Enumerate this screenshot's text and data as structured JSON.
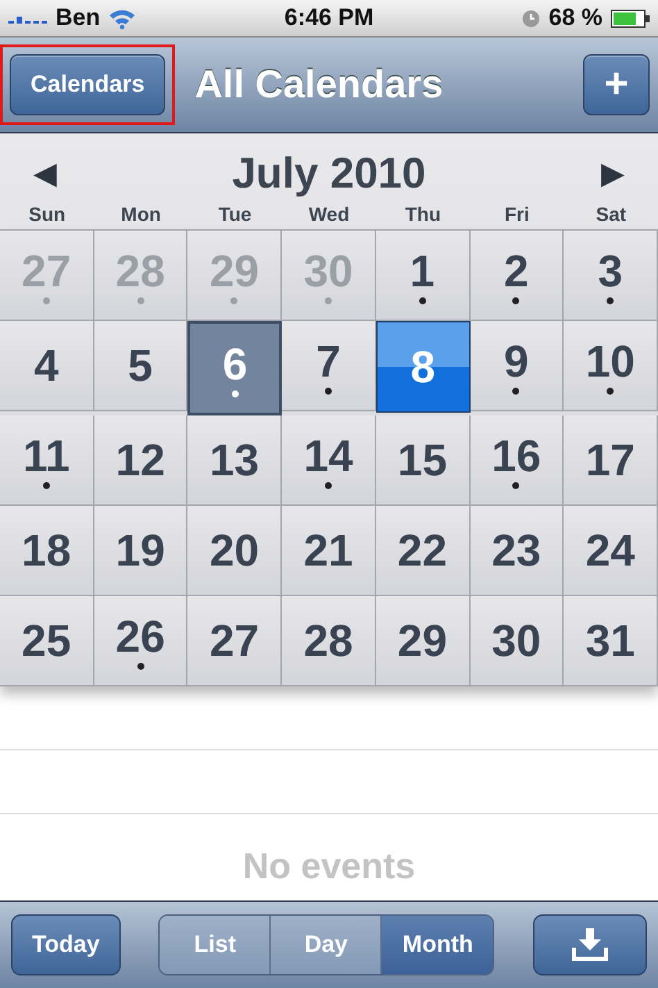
{
  "status_bar": {
    "carrier": "Ben",
    "time": "6:46 PM",
    "battery": "68 %"
  },
  "nav_bar": {
    "left_button": {
      "label": "Calendars",
      "annotated": true
    },
    "title": "All Calendars",
    "right_button": "+"
  },
  "month_header": {
    "title": "July 2010",
    "prev": "◀",
    "next": "▶"
  },
  "weekdays": [
    "Sun",
    "Mon",
    "Tue",
    "Wed",
    "Thu",
    "Fri",
    "Sat"
  ],
  "days": [
    {
      "label": "27",
      "outside": true,
      "event": true,
      "selected": false,
      "today": false
    },
    {
      "label": "28",
      "outside": true,
      "event": true,
      "selected": false,
      "today": false
    },
    {
      "label": "29",
      "outside": true,
      "event": true,
      "selected": false,
      "today": false
    },
    {
      "label": "30",
      "outside": true,
      "event": true,
      "selected": false,
      "today": false
    },
    {
      "label": "1",
      "outside": false,
      "event": true,
      "selected": false,
      "today": false
    },
    {
      "label": "2",
      "outside": false,
      "event": true,
      "selected": false,
      "today": false
    },
    {
      "label": "3",
      "outside": false,
      "event": true,
      "selected": false,
      "today": false
    },
    {
      "label": "4",
      "outside": false,
      "event": false,
      "selected": false,
      "today": false
    },
    {
      "label": "5",
      "outside": false,
      "event": false,
      "selected": false,
      "today": false
    },
    {
      "label": "6",
      "outside": false,
      "event": true,
      "selected": false,
      "today": true
    },
    {
      "label": "7",
      "outside": false,
      "event": true,
      "selected": false,
      "today": false
    },
    {
      "label": "8",
      "outside": false,
      "event": false,
      "selected": true,
      "today": false
    },
    {
      "label": "9",
      "outside": false,
      "event": true,
      "selected": false,
      "today": false
    },
    {
      "label": "10",
      "outside": false,
      "event": true,
      "selected": false,
      "today": false
    },
    {
      "label": "11",
      "outside": false,
      "event": true,
      "selected": false,
      "today": false
    },
    {
      "label": "12",
      "outside": false,
      "event": false,
      "selected": false,
      "today": false
    },
    {
      "label": "13",
      "outside": false,
      "event": false,
      "selected": false,
      "today": false
    },
    {
      "label": "14",
      "outside": false,
      "event": true,
      "selected": false,
      "today": false
    },
    {
      "label": "15",
      "outside": false,
      "event": false,
      "selected": false,
      "today": false
    },
    {
      "label": "16",
      "outside": false,
      "event": true,
      "selected": false,
      "today": false
    },
    {
      "label": "17",
      "outside": false,
      "event": false,
      "selected": false,
      "today": false
    },
    {
      "label": "18",
      "outside": false,
      "event": false,
      "selected": false,
      "today": false
    },
    {
      "label": "19",
      "outside": false,
      "event": false,
      "selected": false,
      "today": false
    },
    {
      "label": "20",
      "outside": false,
      "event": false,
      "selected": false,
      "today": false
    },
    {
      "label": "21",
      "outside": false,
      "event": false,
      "selected": false,
      "today": false
    },
    {
      "label": "22",
      "outside": false,
      "event": false,
      "selected": false,
      "today": false
    },
    {
      "label": "23",
      "outside": false,
      "event": false,
      "selected": false,
      "today": false
    },
    {
      "label": "24",
      "outside": false,
      "event": false,
      "selected": false,
      "today": false
    },
    {
      "label": "25",
      "outside": false,
      "event": false,
      "selected": false,
      "today": false
    },
    {
      "label": "26",
      "outside": false,
      "event": true,
      "selected": false,
      "today": false
    },
    {
      "label": "27",
      "outside": false,
      "event": false,
      "selected": false,
      "today": false
    },
    {
      "label": "28",
      "outside": false,
      "event": false,
      "selected": false,
      "today": false
    },
    {
      "label": "29",
      "outside": false,
      "event": false,
      "selected": false,
      "today": false
    },
    {
      "label": "30",
      "outside": false,
      "event": false,
      "selected": false,
      "today": false
    },
    {
      "label": "31",
      "outside": false,
      "event": false,
      "selected": false,
      "today": false
    }
  ],
  "events": {
    "message": "No events"
  },
  "toolbar": {
    "today_button": "Today",
    "views": [
      {
        "label": "List",
        "selected": false
      },
      {
        "label": "Day",
        "selected": false
      },
      {
        "label": "Month",
        "selected": true
      }
    ]
  }
}
